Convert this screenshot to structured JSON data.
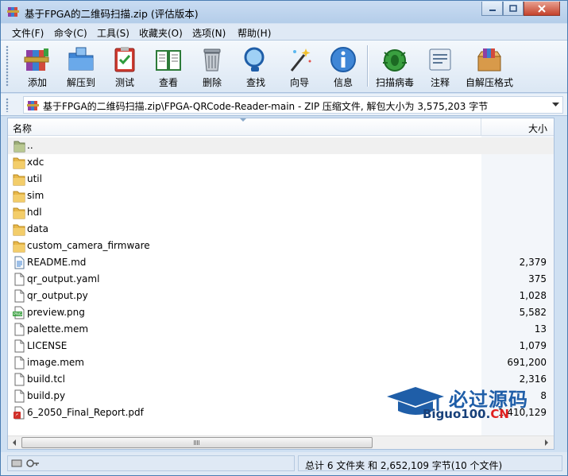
{
  "window": {
    "title": "基于FPGA的二维码扫描.zip (评估版本)"
  },
  "menu": [
    {
      "label": "文件(F)"
    },
    {
      "label": "命令(C)"
    },
    {
      "label": "工具(S)"
    },
    {
      "label": "收藏夹(O)"
    },
    {
      "label": "选项(N)"
    },
    {
      "label": "帮助(H)"
    }
  ],
  "toolbar": [
    {
      "label": "添加",
      "icon": "add-books-icon"
    },
    {
      "label": "解压到",
      "icon": "extract-folder-icon"
    },
    {
      "label": "测试",
      "icon": "test-clipboard-icon"
    },
    {
      "label": "查看",
      "icon": "view-book-icon"
    },
    {
      "label": "删除",
      "icon": "trash-bin-icon"
    },
    {
      "label": "查找",
      "icon": "find-magnifier-icon"
    },
    {
      "label": "向导",
      "icon": "wizard-wand-icon"
    },
    {
      "label": "信息",
      "icon": "info-icon"
    },
    {
      "label": "扫描病毒",
      "icon": "virus-scan-bug-icon"
    },
    {
      "label": "注释",
      "icon": "comment-note-icon"
    },
    {
      "label": "自解压格式",
      "icon": "sfx-box-icon"
    }
  ],
  "address": {
    "path": "基于FPGA的二维码扫描.zip\\FPGA-QRCode-Reader-main - ZIP 压缩文件, 解包大小为 3,575,203 字节"
  },
  "list": {
    "columns": {
      "name": "名称",
      "size": "大小"
    },
    "rows": [
      {
        "name": "..",
        "size": "",
        "type": "parent"
      },
      {
        "name": "xdc",
        "size": "",
        "type": "folder"
      },
      {
        "name": "util",
        "size": "",
        "type": "folder"
      },
      {
        "name": "sim",
        "size": "",
        "type": "folder"
      },
      {
        "name": "hdl",
        "size": "",
        "type": "folder"
      },
      {
        "name": "data",
        "size": "",
        "type": "folder"
      },
      {
        "name": "custom_camera_firmware",
        "size": "",
        "type": "folder"
      },
      {
        "name": "README.md",
        "size": "2,379",
        "type": "doc"
      },
      {
        "name": "qr_output.yaml",
        "size": "375",
        "type": "file"
      },
      {
        "name": "qr_output.py",
        "size": "1,028",
        "type": "file"
      },
      {
        "name": "preview.png",
        "size": "5,582",
        "type": "png"
      },
      {
        "name": "palette.mem",
        "size": "13",
        "type": "file"
      },
      {
        "name": "LICENSE",
        "size": "1,079",
        "type": "file"
      },
      {
        "name": "image.mem",
        "size": "691,200",
        "type": "file"
      },
      {
        "name": "build.tcl",
        "size": "2,316",
        "type": "file"
      },
      {
        "name": "build.py",
        "size": "8",
        "type": "file"
      },
      {
        "name": "6_2050_Final_Report.pdf",
        "size": "1,410,129",
        "type": "pdf"
      }
    ]
  },
  "status": {
    "summary": "总计 6 文件夹 和 2,652,109 字节(10 个文件)"
  },
  "watermark": {
    "top": "必过源码",
    "bottom_main": "Biguo100.",
    "bottom_suffix": "CN"
  },
  "colors": {
    "accent": "#1f5ea8",
    "folder": "#e8b84a",
    "watermark_red": "#e02020"
  }
}
